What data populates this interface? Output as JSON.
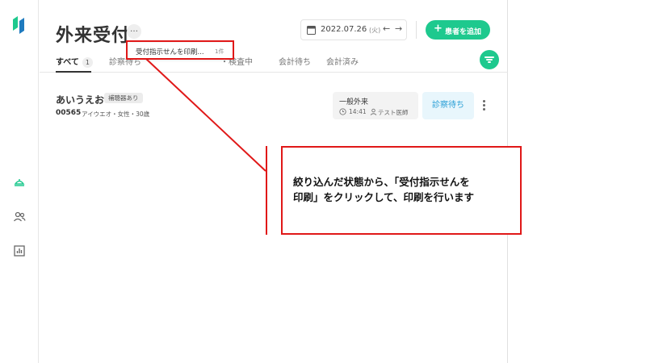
{
  "page": {
    "title": "外来受付",
    "more_label": "…",
    "date": "2022.07.26",
    "weekday": "(火)",
    "prev_arrow": "←",
    "next_arrow": "→",
    "add_button": "患者を追加",
    "add_plus": "+"
  },
  "tabs": [
    {
      "label": "すべて",
      "count": "1",
      "active": true
    },
    {
      "label": "診察待ち"
    },
    {
      "label": "・検査中"
    },
    {
      "label": "会計待ち"
    },
    {
      "label": "会計済み"
    }
  ],
  "print_popup": {
    "label": "受付指示せんを印刷...",
    "count": "1件"
  },
  "patient": {
    "name": "あいうえお",
    "badge": "補聴器あり",
    "id": "00565",
    "meta": "アイウエオ・女性・30歳",
    "visit_type": "一般外来",
    "time": "14:41",
    "doctor": "テスト医師",
    "status": "診察待ち"
  },
  "callout": {
    "line1": "絞り込んだ状態から、「受付指示せんを",
    "line2": "印刷」をクリックして、印刷を行います"
  },
  "colors": {
    "accent": "#1ec98e",
    "annotation": "#e01818",
    "status_text": "#2a9fd6"
  }
}
